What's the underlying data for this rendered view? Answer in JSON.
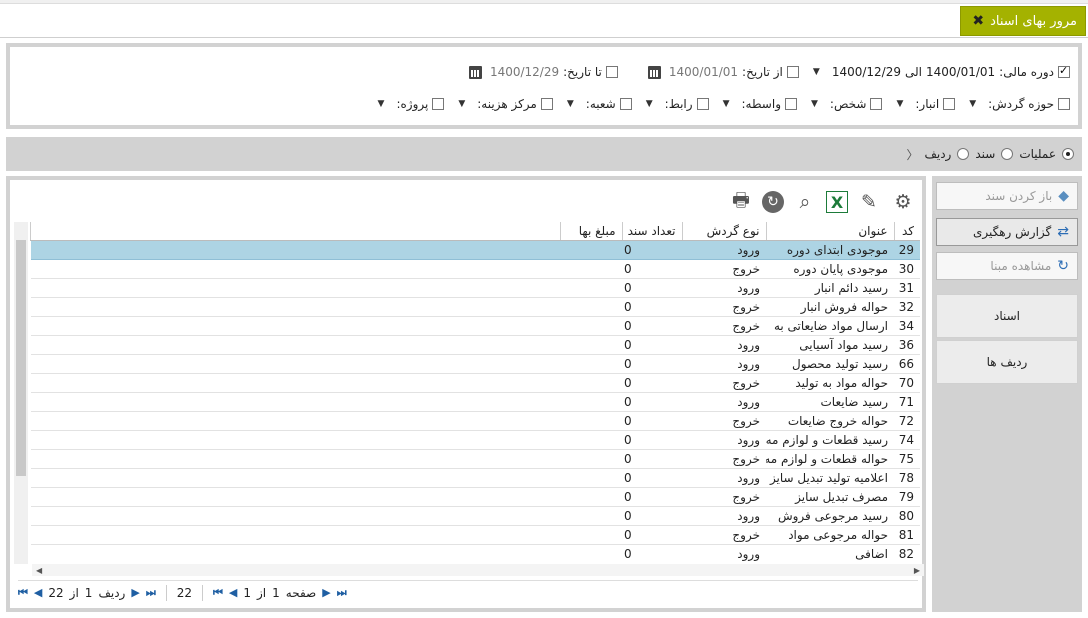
{
  "window": {
    "title": "مرور بهای اسناد",
    "close_icon": "close-icon"
  },
  "filters": {
    "fiscal_period": {
      "label": "دوره مالی:",
      "checked": true,
      "from": "1400/01/01",
      "sep": "الی",
      "to": "1400/12/29"
    },
    "from_date": {
      "label": "از تاریخ:",
      "value": "1400/01/01"
    },
    "to_date": {
      "label": "تا تاریخ:",
      "value": "1400/12/29"
    },
    "row2": [
      {
        "label": "حوزه گردش:"
      },
      {
        "label": "انبار:"
      },
      {
        "label": "شخص:"
      },
      {
        "label": "واسطه:"
      },
      {
        "label": "رابط:"
      },
      {
        "label": "شعبه:"
      },
      {
        "label": "مرکز هزینه:"
      },
      {
        "label": "پروژه:"
      }
    ]
  },
  "view_mode": {
    "options": [
      {
        "label": "عملیات",
        "selected": true
      },
      {
        "label": "سند",
        "selected": false
      },
      {
        "label": "ردیف",
        "selected": false
      }
    ]
  },
  "table": {
    "columns": [
      "کد",
      "عنوان",
      "نوع گردش",
      "تعداد سند",
      "مبلغ بها"
    ],
    "rows": [
      [
        "29",
        "موجودی ابتدای دوره",
        "ورود",
        "0",
        ""
      ],
      [
        "30",
        "موجودی پایان دوره",
        "خروج",
        "0",
        ""
      ],
      [
        "31",
        "رسید دائم انبار",
        "ورود",
        "0",
        ""
      ],
      [
        "32",
        "حواله فروش انبار",
        "خروج",
        "0",
        ""
      ],
      [
        "34",
        "ارسال مواد ضایعاتی به",
        "خروج",
        "0",
        ""
      ],
      [
        "36",
        "رسید مواد آسیایی",
        "ورود",
        "0",
        ""
      ],
      [
        "66",
        "رسید تولید محصول",
        "ورود",
        "0",
        ""
      ],
      [
        "70",
        "حواله مواد به تولید",
        "خروج",
        "0",
        ""
      ],
      [
        "71",
        "رسید ضایعات",
        "ورود",
        "0",
        ""
      ],
      [
        "72",
        "حواله خروج ضایعات",
        "خروج",
        "0",
        ""
      ],
      [
        "74",
        "رسید قطعات و لوازم مه",
        "ورود",
        "0",
        ""
      ],
      [
        "75",
        "حواله قطعات و لوازم مه",
        "خروج",
        "0",
        ""
      ],
      [
        "78",
        "اعلامیه تولید تبدیل سایز",
        "ورود",
        "0",
        ""
      ],
      [
        "79",
        "مصرف تبدیل سایز",
        "خروج",
        "0",
        ""
      ],
      [
        "80",
        "رسید مرجوعی فروش",
        "ورود",
        "0",
        ""
      ],
      [
        "81",
        "حواله مرجوعی مواد",
        "خروج",
        "0",
        ""
      ],
      [
        "82",
        "اضافی",
        "ورود",
        "0",
        ""
      ]
    ]
  },
  "pager": {
    "row_label": "ردیف",
    "row_current": "1",
    "of_label": "از",
    "row_total": "22",
    "count": "22",
    "page_label": "صفحه",
    "page_current": "1",
    "page_total": "1"
  },
  "side": {
    "open_doc": "باز کردن سند",
    "trace_report": "گزارش رهگیری",
    "view_base": "مشاهده مبنا",
    "docs": "اسناد",
    "rows": "ردیف ها"
  }
}
